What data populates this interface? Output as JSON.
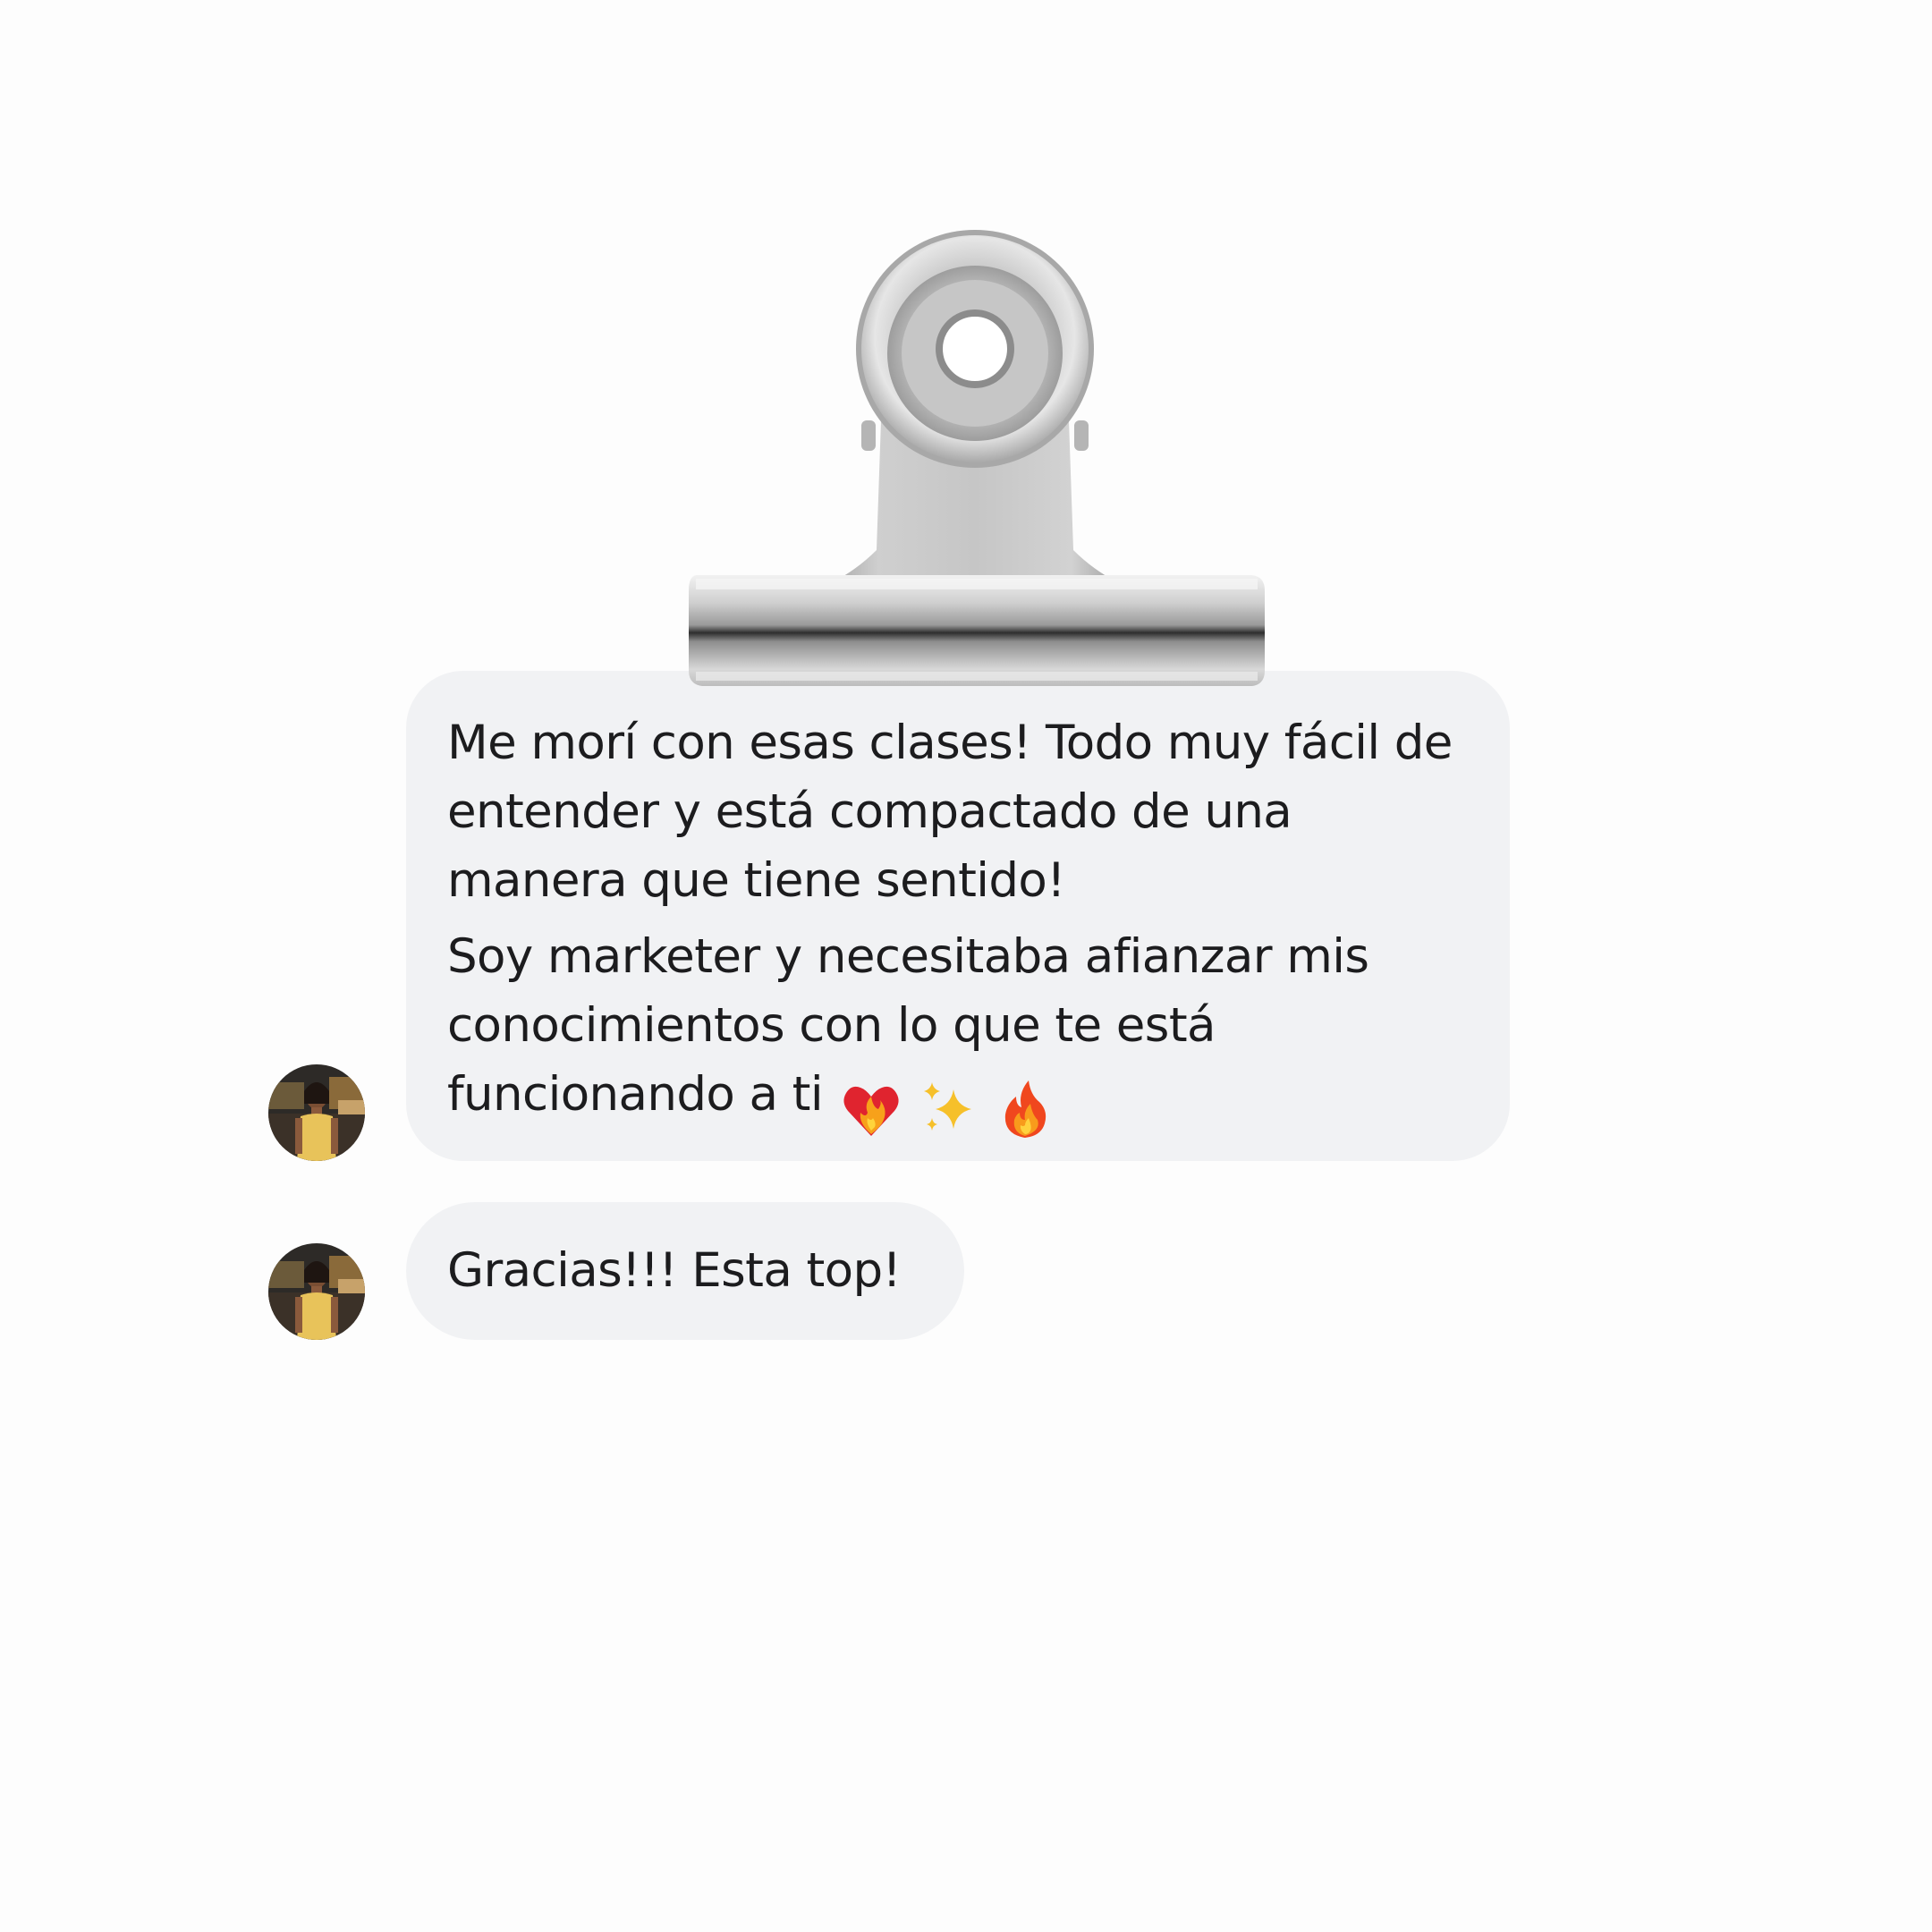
{
  "conversation": {
    "messages": [
      {
        "sender": "incoming",
        "paragraphs": [
          "Me morí con esas clases! Todo muy fácil de entender y está compactado de una manera que tiene sentido!",
          "Soy marketer y necesitaba afianzar mis conocimientos con lo que te está funcionando a ti"
        ],
        "emojis": [
          "heart-on-fire-icon",
          "sparkles-icon",
          "fire-icon"
        ]
      },
      {
        "sender": "incoming",
        "paragraphs": [
          "Gracias!!! Esta top!"
        ]
      }
    ]
  },
  "colors": {
    "background": "#fdfdfd",
    "bubble": "#f1f2f4",
    "text": "#1c1c1e",
    "clip_metal": "#c9c9c9"
  }
}
